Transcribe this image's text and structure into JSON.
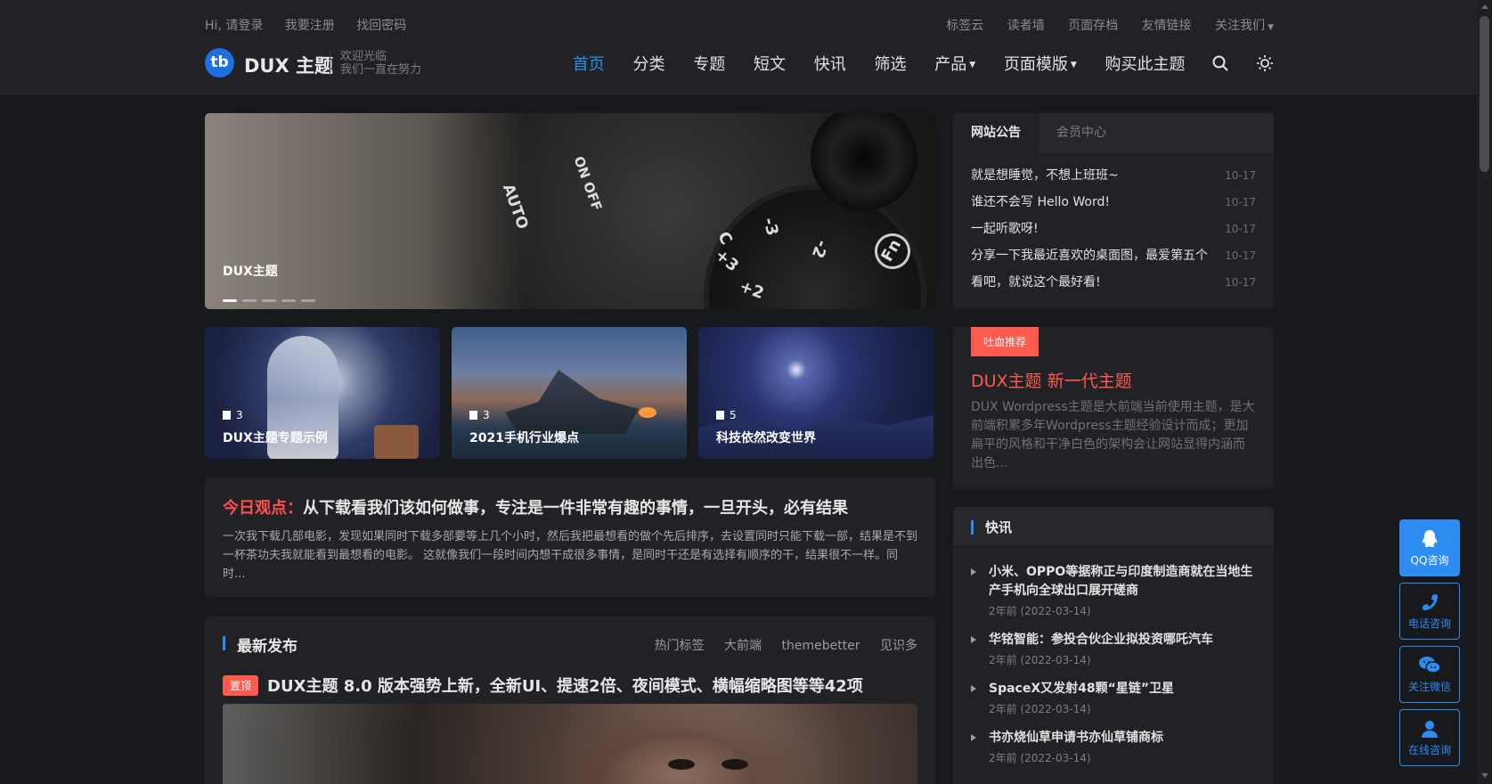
{
  "topbar": {
    "left": [
      "Hi, 请登录",
      "我要注册",
      "找回密码"
    ],
    "right": [
      "标签云",
      "读者墙",
      "页面存档",
      "友情链接",
      "关注我们"
    ]
  },
  "brand": {
    "logo_glyph": "tb",
    "name": "DUX 主题",
    "slogan_1": "欢迎光临",
    "slogan_2": "我们一直在努力"
  },
  "nav": {
    "items": [
      "首页",
      "分类",
      "专题",
      "短文",
      "快讯",
      "筛选",
      "产品",
      "页面模版",
      "购买此主题"
    ],
    "active_index": 0
  },
  "slider": {
    "caption": "DUX主题",
    "dial": {
      "mode1": "AUTO",
      "mode2": "ON OFF",
      "fn": "Fn",
      "c": "C",
      "m3": "-3",
      "m2": "-2",
      "p3": "+3",
      "p2": "+2"
    },
    "slides": 5,
    "active": 0
  },
  "topics": [
    {
      "count": "3",
      "title": "DUX主题专题示例"
    },
    {
      "count": "3",
      "title": "2021手机行业爆点"
    },
    {
      "count": "5",
      "title": "科技依然改变世界"
    }
  ],
  "viewpoint": {
    "label": "今日观点：",
    "title": "从下载看我们该如何做事，专注是一件非常有趣的事情，一旦开头，必有结果",
    "desc": "一次我下载几部电影，发现如果同时下载多部要等上几个小时，然后我把最想看的做个先后排序，去设置同时只能下载一部，结果是不到一杯茶功夫我就能看到最想看的电影。 这就像我们一段时间内想干成很多事情，是同时干还是有选择有顺序的干，结果很不一样。同时..."
  },
  "latest": {
    "heading": "最新发布",
    "tags": [
      "热门标签",
      "大前端",
      "themebetter",
      "见识多"
    ],
    "sticky_badge": "置顶",
    "sticky_title": "DUX主题 8.0 版本强势上新，全新UI、提速2倍、夜间模式、横幅缩略图等等42项"
  },
  "notice": {
    "tabs": [
      "网站公告",
      "会员中心"
    ],
    "items": [
      {
        "title": "就是想睡觉，不想上班班~",
        "date": "10-17"
      },
      {
        "title": "谁还不会写 Hello Word!",
        "date": "10-17"
      },
      {
        "title": "一起听歌呀!",
        "date": "10-17"
      },
      {
        "title": "分享一下我最近喜欢的桌面图，最爱第五个",
        "date": "10-17"
      },
      {
        "title": "看吧，就说这个最好看!",
        "date": "10-17"
      }
    ]
  },
  "promo": {
    "tag": "吐血推荐",
    "title": "DUX主题 新一代主题",
    "desc": "DUX Wordpress主题是大前端当前使用主题，是大前端积累多年Wordpress主题经验设计而成；更加扁平的风格和干净白色的架构会让网站显得内涵而出色..."
  },
  "flash": {
    "heading": "快讯",
    "items": [
      {
        "title": "小米、OPPO等据称正与印度制造商就在当地生产手机向全球出口展开磋商",
        "date": "2年前 (2022-03-14)"
      },
      {
        "title": "华铭智能：参投合伙企业拟投资哪吒汽车",
        "date": "2年前 (2022-03-14)"
      },
      {
        "title": "SpaceX又发射48颗“星链”卫星",
        "date": "2年前 (2022-03-14)"
      },
      {
        "title": "书亦烧仙草申请书亦仙草铺商标",
        "date": "2年前 (2022-03-14)"
      }
    ]
  },
  "contact": [
    "QQ咨询",
    "电话咨询",
    "关注微信",
    "在线咨询"
  ],
  "colors": {
    "accent": "#2d8cf0",
    "hot": "#ff5a4f",
    "bg": "#17191c",
    "card": "#202226"
  }
}
